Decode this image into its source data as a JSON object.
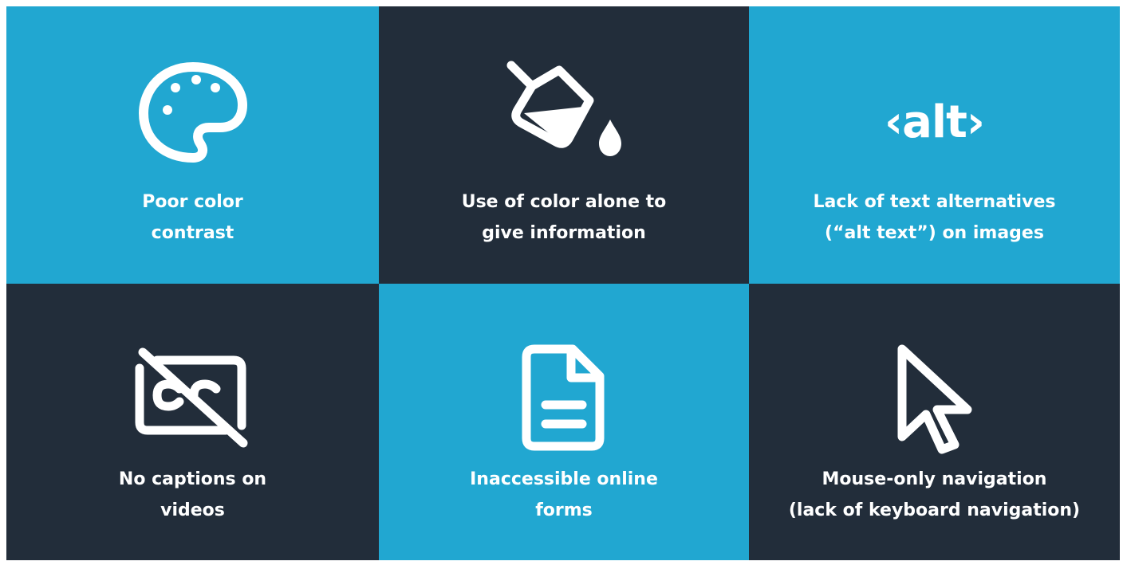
{
  "colors": {
    "blue": "#21a7d1",
    "dark": "#222d3a",
    "text": "#ffffff"
  },
  "tiles": [
    {
      "icon": "palette-icon",
      "lines": [
        "Poor color",
        "contrast"
      ]
    },
    {
      "icon": "paint-bucket-icon",
      "lines": [
        "Use of color alone to",
        "give information"
      ]
    },
    {
      "icon": "alt-tag-icon",
      "icon_text": "‹alt›",
      "lines": [
        "Lack of text alternatives",
        "(“alt text”) on images"
      ]
    },
    {
      "icon": "closed-captions-off-icon",
      "lines": [
        "No captions on",
        "videos"
      ]
    },
    {
      "icon": "document-icon",
      "lines": [
        "Inaccessible online",
        "forms"
      ]
    },
    {
      "icon": "mouse-cursor-icon",
      "lines": [
        "Mouse-only navigation",
        "(lack of keyboard navigation)"
      ]
    }
  ]
}
